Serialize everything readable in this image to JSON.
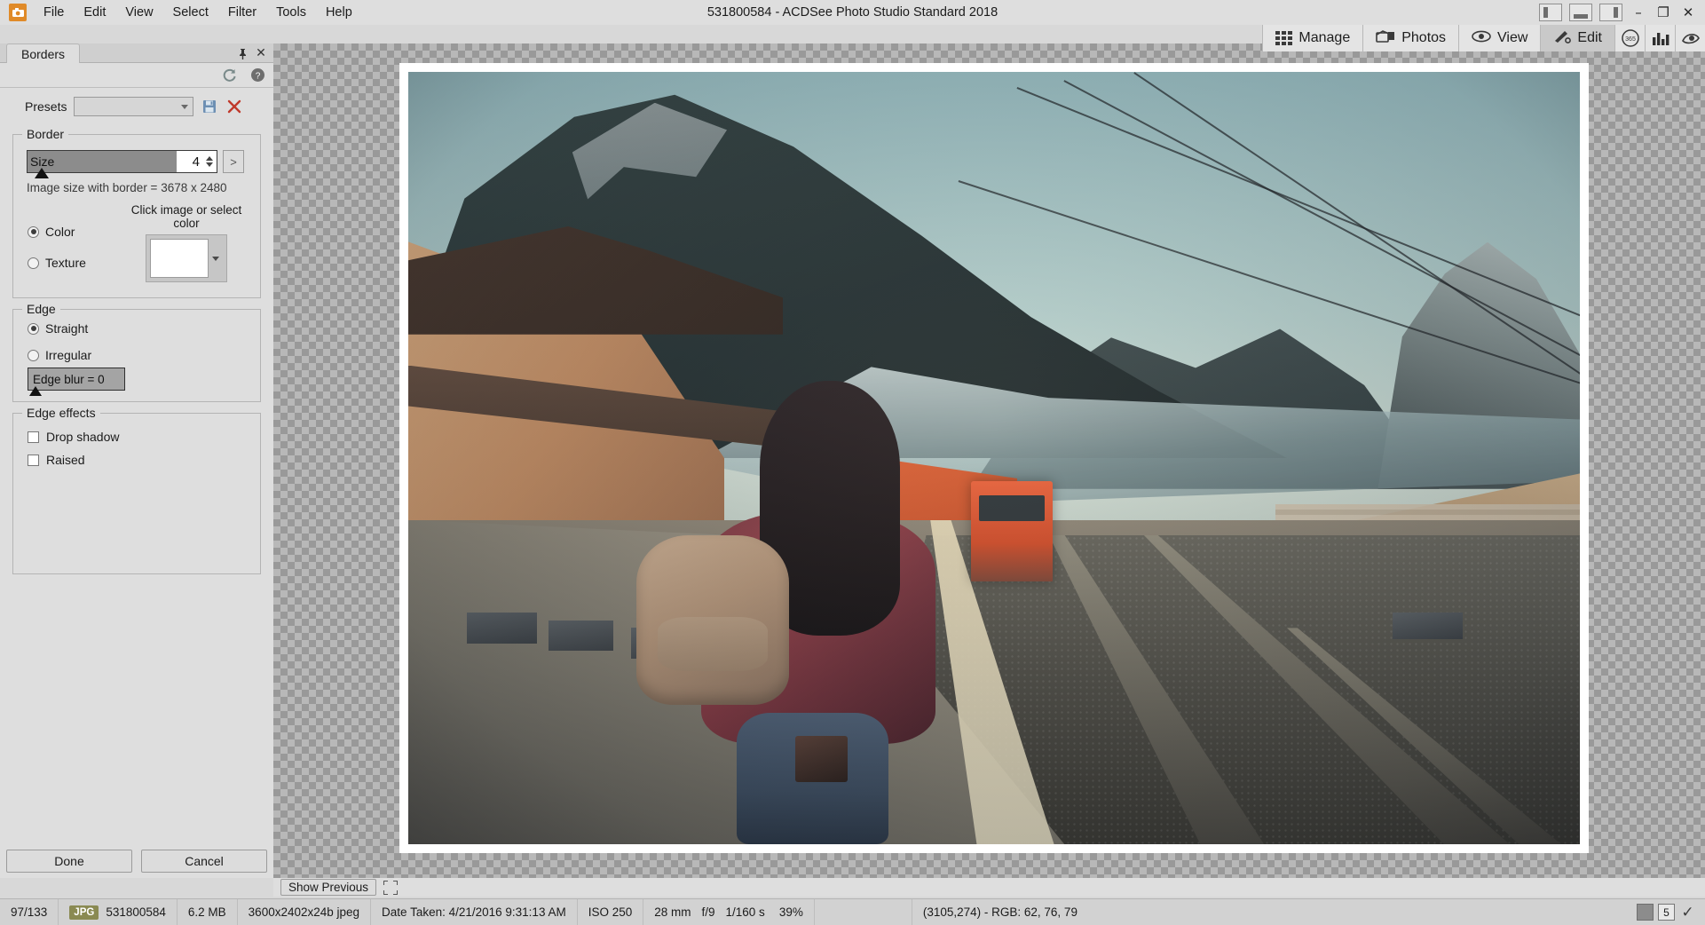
{
  "window": {
    "title": "531800584 - ACDSee Photo Studio Standard 2018",
    "minimize": "–",
    "maximize": "❐",
    "close": "✕"
  },
  "menu": {
    "logo_icon": "camera-icon",
    "items": [
      "File",
      "Edit",
      "View",
      "Select",
      "Filter",
      "Tools",
      "Help"
    ]
  },
  "modes": {
    "tabs": [
      {
        "label": "Manage",
        "icon": "grid-icon",
        "active": false
      },
      {
        "label": "Photos",
        "icon": "photos-icon",
        "active": false
      },
      {
        "label": "View",
        "icon": "eye-icon",
        "active": false
      },
      {
        "label": "Edit",
        "icon": "edit-tools-icon",
        "active": true
      }
    ],
    "extra_buttons": [
      {
        "name": "acdsee-365-button",
        "label": "365"
      },
      {
        "name": "chart-button",
        "label": "bar-chart-icon"
      },
      {
        "name": "eye-swoosh-button",
        "label": "eye-swoosh-icon"
      }
    ],
    "layout_buttons": [
      "layout-left-panel",
      "layout-bottom-panel",
      "layout-right-panel"
    ]
  },
  "panel": {
    "tab_label": "Borders",
    "pin_icon": "pin-icon",
    "close_icon": "close-icon",
    "reset_icon": "reset-icon",
    "help_icon": "help-icon",
    "presets": {
      "label": "Presets",
      "value": "",
      "placeholder": "",
      "save_icon": "save-icon",
      "delete_icon": "delete-icon"
    },
    "border_group": {
      "legend": "Border",
      "size_label": "Size",
      "size_value": "4",
      "size_fill_percent": 79,
      "more_button": ">",
      "image_size_text": "Image size with border = 3678 x 2480",
      "swatch_caption": "Click image or select color",
      "fill_options": [
        {
          "label": "Color",
          "selected": true
        },
        {
          "label": "Texture",
          "selected": false
        }
      ],
      "swatch_color": "#ffffff"
    },
    "edge_group": {
      "legend": "Edge",
      "options": [
        {
          "label": "Straight",
          "selected": true
        },
        {
          "label": "Irregular",
          "selected": false
        }
      ],
      "edge_blur_label": "Edge blur = 0"
    },
    "edge_effects_group": {
      "legend": "Edge effects",
      "checkboxes": [
        {
          "label": "Drop shadow",
          "checked": false
        },
        {
          "label": "Raised",
          "checked": false
        }
      ]
    },
    "actions": {
      "done": "Done",
      "cancel": "Cancel"
    }
  },
  "canvas": {
    "show_previous": "Show Previous",
    "expand_icon": "expand-icon"
  },
  "status": {
    "counter": "97/133",
    "format_badge": "JPG",
    "filename": "531800584",
    "filesize": "6.2 MB",
    "dimensions": "3600x2402x24b jpeg",
    "date_taken": "Date Taken: 4/21/2016 9:31:13 AM",
    "iso": "ISO 250",
    "focal": "28 mm",
    "aperture": "f/9",
    "shutter": "1/160 s",
    "zoom": "39%",
    "cursor_readout": "(3105,274) - RGB: 62, 76, 79",
    "right_boxes": [
      "fill-swatch",
      "5",
      "✓"
    ]
  },
  "colors": {
    "chrome": "#dedede",
    "accent_logo": "#e08a28",
    "jpg_badge": "#8a8a52",
    "slider_fill": "#8c8c8c",
    "delete_red": "#c0392b",
    "save_blue": "#6d8fb3"
  }
}
